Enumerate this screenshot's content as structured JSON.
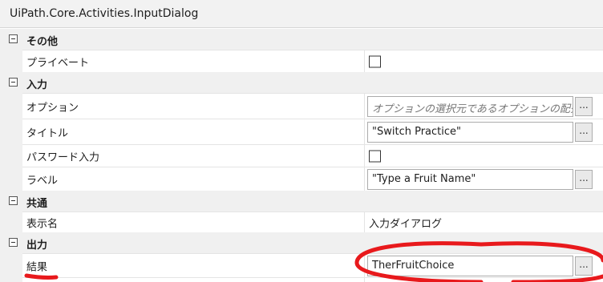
{
  "header": {
    "title": "UiPath.Core.Activities.InputDialog"
  },
  "categories": {
    "misc": "その他",
    "input": "入力",
    "common": "共通",
    "output": "出力"
  },
  "properties": {
    "private": {
      "label": "プライベート",
      "checked": false
    },
    "options": {
      "label": "オプション",
      "placeholder": "オプションの選択元であるオプションの配列"
    },
    "title": {
      "label": "タイトル",
      "value": "\"Switch Practice\""
    },
    "password_input": {
      "label": "パスワード入力",
      "checked": false
    },
    "label": {
      "label": "ラベル",
      "value": "\"Type a Fruit Name\""
    },
    "display_name": {
      "label": "表示名",
      "value": "入力ダイアログ"
    },
    "result": {
      "label": "結果",
      "value": "TherFruitChoice"
    }
  },
  "ellipsis_label": "...",
  "annotation_color": "#e8191c",
  "icons": {
    "collapse": "minus-box-icon",
    "checkbox": "checkbox-empty-icon"
  }
}
